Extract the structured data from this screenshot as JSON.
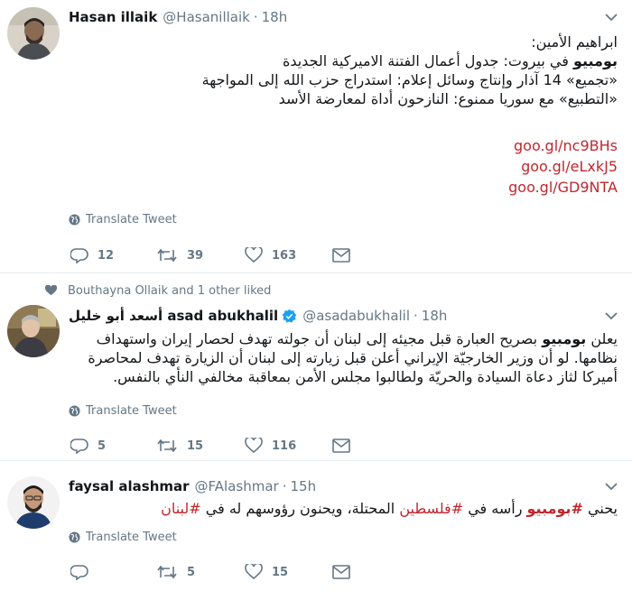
{
  "tweets": [
    {
      "name": "Hasan illaik",
      "handle": "@Hasanillaik",
      "time": "18h",
      "lines": [
        {
          "text": "ابراهيم الأمين:"
        },
        {
          "bold": "بومبيو",
          "text": " في بيروت: جدول أعمال الفتنة الاميركية الجديدة"
        },
        {
          "text": "«تجميع» 14 آذار وإنتاج وسائل إعلام: استدراج حزب الله إلى المواجهة"
        },
        {
          "text": "«التطبيع» مع سوريا ممنوع: النازحون أداة لمعارضة الأسد"
        }
      ],
      "links": [
        "goo.gl/nc9BHs",
        "goo.gl/eLxkJ5",
        "goo.gl/GD9NTA"
      ],
      "translate": "Translate Tweet",
      "replies": "12",
      "retweets": "39",
      "likes": "163"
    },
    {
      "social_context": "Bouthayna Ollaik and 1 other liked",
      "name": "أسعد أبو خليل asad abukhalil",
      "handle": "@asadabukhalil",
      "time": "18h",
      "lines": [
        {
          "pre": "يعلن ",
          "bold": "بومبيو",
          "text": " بصريح العبارة قبل مجيئه إلى لبنان أن جولته تهدف لحصار إيران واستهداف"
        },
        {
          "text": "نظامها.  لو أن وزير الخارجيّة الإيراني أعلن قبل زيارته إلى لبنان أن الزيارة تهدف لمحاصرة"
        },
        {
          "text": "أميركا لثاز دعاة السيادة والحريّة ولطالبوا مجلس الأمن بمعاقبة مخالفي النأي بالنفس."
        }
      ],
      "translate": "Translate Tweet",
      "replies": "5",
      "retweets": "15",
      "likes": "116"
    },
    {
      "name": "faysal alashmar",
      "handle": "@FAlashmar",
      "time": "15h",
      "line_parts": {
        "p1": "يحني ",
        "h1": "#بومبيو",
        "p2": " رأسه في ",
        "h2": "#فلسطين",
        "p3": " المحتلة، ويحنون رؤوسهم له في ",
        "h3": "#لبنان"
      },
      "translate": "Translate Tweet",
      "replies": "",
      "retweets": "5",
      "likes": "15"
    }
  ],
  "colors": {
    "link": "#c0272d",
    "muted": "#657786",
    "verified": "#1da1f2",
    "border": "#e6ecf0"
  },
  "icons": [
    "chevron-down-icon",
    "globe-icon",
    "reply-icon",
    "retweet-icon",
    "heart-icon",
    "envelope-icon",
    "verified-badge-icon"
  ]
}
